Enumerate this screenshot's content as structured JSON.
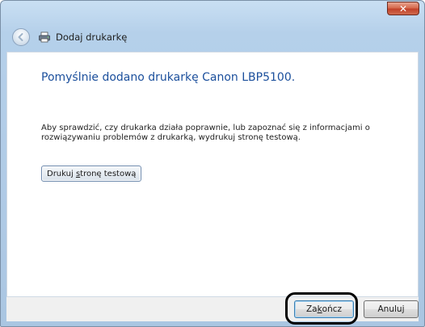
{
  "window": {
    "title": "Dodaj drukarkę",
    "close_label": "✕"
  },
  "main": {
    "heading": "Pomyślnie dodano drukarkę Canon LBP5100.",
    "description": "Aby sprawdzić, czy drukarka działa poprawnie, lub zapoznać się z informacjami o rozwiązywaniu problemów z drukarką, wydrukuj stronę testową.",
    "print_test_button": {
      "before": "Drukuj ",
      "accel": "s",
      "after": "tronę testową"
    }
  },
  "footer": {
    "finish_button": {
      "before": "Za",
      "accel": "k",
      "after": "ończ"
    },
    "cancel_label": "Anuluj"
  },
  "icons": {
    "back": "back-arrow-icon",
    "printer": "printer-icon",
    "close": "close-icon"
  },
  "colors": {
    "heading": "#1b4f9c",
    "close_button": "#c2432a",
    "highlight": "#000000"
  }
}
